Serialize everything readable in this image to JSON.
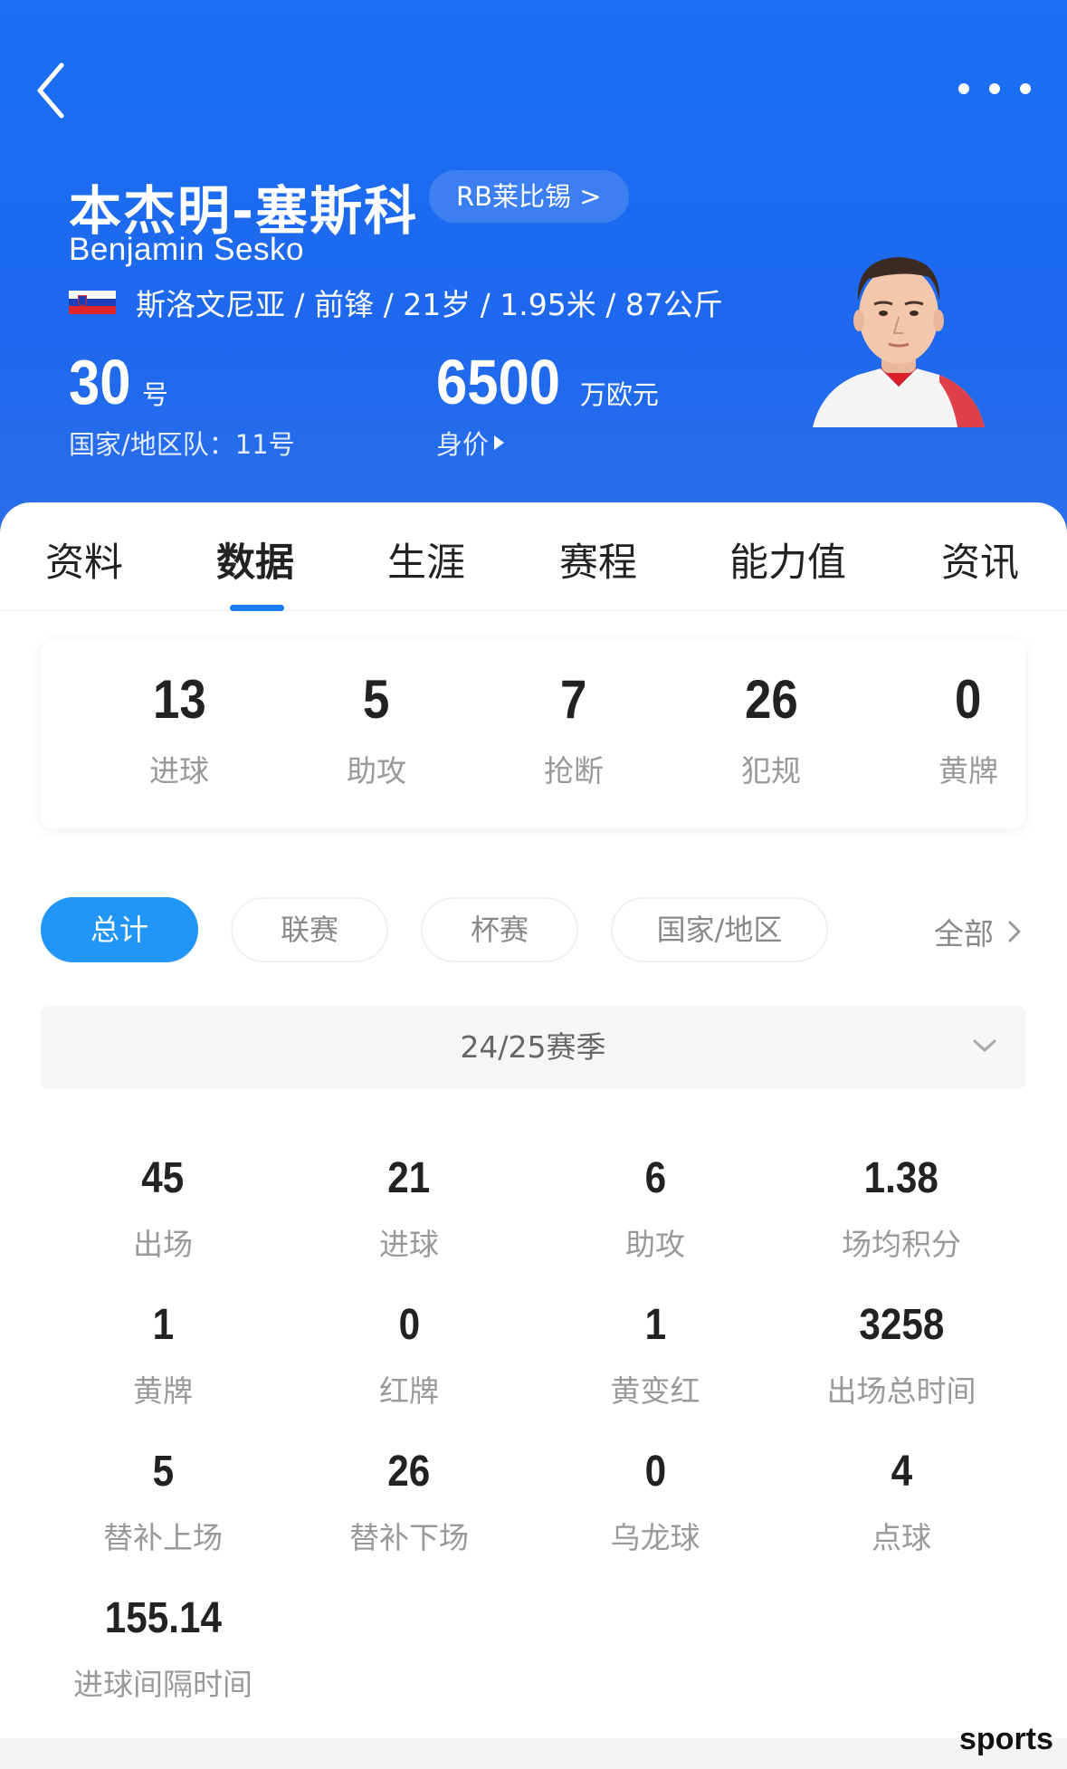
{
  "header": {
    "name_cn": "本杰明-塞斯科",
    "club_chip": "RB莱比锡 >",
    "name_en": "Benjamin Sesko",
    "info": "斯洛文尼亚 / 前锋 / 21岁 / 1.95米 / 87公斤",
    "shirt_number": "30",
    "shirt_unit": "号",
    "national_team": "国家/地区队：11号",
    "market_value": "6500",
    "market_value_unit": "万欧元",
    "market_value_label": "身价",
    "flag_icon": "slovenia-flag-icon",
    "avatar_icon": "player-photo"
  },
  "tabs": [
    "资料",
    "数据",
    "生涯",
    "赛程",
    "能力值",
    "资讯"
  ],
  "active_tab": "数据",
  "summary": [
    {
      "value": "13",
      "label": "进球"
    },
    {
      "value": "5",
      "label": "助攻"
    },
    {
      "value": "7",
      "label": "抢断"
    },
    {
      "value": "26",
      "label": "犯规"
    },
    {
      "value": "0",
      "label": "黄牌"
    }
  ],
  "filters": [
    "总计",
    "联赛",
    "杯赛",
    "国家/地区"
  ],
  "active_filter": "总计",
  "all_link": "全部",
  "season": "24/25赛季",
  "stats": [
    {
      "value": "45",
      "label": "出场"
    },
    {
      "value": "21",
      "label": "进球"
    },
    {
      "value": "6",
      "label": "助攻"
    },
    {
      "value": "1.38",
      "label": "场均积分"
    },
    {
      "value": "1",
      "label": "黄牌"
    },
    {
      "value": "0",
      "label": "红牌"
    },
    {
      "value": "1",
      "label": "黄变红"
    },
    {
      "value": "3258",
      "label": "出场总时间"
    },
    {
      "value": "5",
      "label": "替补上场"
    },
    {
      "value": "26",
      "label": "替补下场"
    },
    {
      "value": "0",
      "label": "乌龙球"
    },
    {
      "value": "4",
      "label": "点球"
    },
    {
      "value": "155.14",
      "label": "进球间隔时间"
    }
  ],
  "watermark": "sports",
  "colors": {
    "header_blue": "#1e68ee",
    "accent_blue": "#2196f7",
    "tab_underline": "#1b7ef6"
  }
}
